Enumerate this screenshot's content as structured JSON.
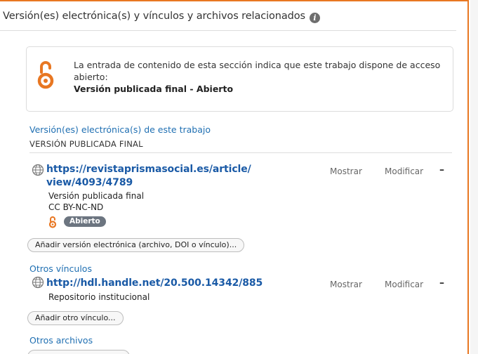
{
  "header": {
    "title": "Versión(es) electrónica(s) y vínculos y archivos relacionados",
    "info_icon": "info-icon"
  },
  "open_access": {
    "message": "La entrada de contenido de esta sección indica que este trabajo dispone de acceso abierto:",
    "version": "Versión publicada final - Abierto",
    "icon": "open-access-lock-icon",
    "color": "#e87722"
  },
  "electronic_versions": {
    "section_title": "Versión(es) electrónica(s) de este trabajo",
    "group_label": "VERSIÓN PUBLICADA FINAL",
    "items": [
      {
        "url_line1": "https://revistaprismasocial.es/article/",
        "url_line2": "view/4093/4789",
        "version": "Versión publicada final",
        "license": "CC BY-NC-ND",
        "badge": "Abierto",
        "show_label": "Mostrar",
        "edit_label": "Modificar",
        "remove_label": "–"
      }
    ],
    "add_button": "Añadir versión electrónica (archivo, DOI o vínculo)..."
  },
  "other_links": {
    "section_title": "Otros vínculos",
    "items": [
      {
        "url": "http://hdl.handle.net/20.500.14342/885",
        "description": "Repositorio institucional",
        "show_label": "Mostrar",
        "edit_label": "Modificar",
        "remove_label": "–"
      }
    ],
    "add_button": "Añadir otro vínculo..."
  },
  "other_files": {
    "section_title": "Otros archivos"
  },
  "colors": {
    "accent": "#e87722",
    "link": "#1a5aa6",
    "section_label": "#1f6fb2",
    "badge": "#6c7580"
  }
}
